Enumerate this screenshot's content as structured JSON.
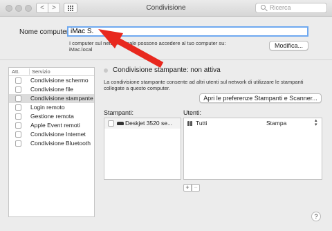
{
  "window": {
    "title": "Condivisione"
  },
  "toolbar": {
    "search_placeholder": "Ricerca",
    "back_glyph": "<",
    "forward_glyph": ">"
  },
  "computer": {
    "label": "Nome computer:",
    "value": "iMac S.",
    "info_line1": "I computer sul network locale possono accedere al tuo computer su:",
    "info_line2": "iMac.local",
    "edit_button": "Modifica..."
  },
  "services": {
    "header_on": "Att.",
    "header_service": "Servizio",
    "items": [
      {
        "label": "Condivisione schermo",
        "checked": false,
        "selected": false
      },
      {
        "label": "Condivisione file",
        "checked": false,
        "selected": false
      },
      {
        "label": "Condivisione stampante",
        "checked": false,
        "selected": true
      },
      {
        "label": "Login remoto",
        "checked": false,
        "selected": false
      },
      {
        "label": "Gestione remota",
        "checked": false,
        "selected": false
      },
      {
        "label": "Apple Event remoti",
        "checked": false,
        "selected": false
      },
      {
        "label": "Condivisione Internet",
        "checked": false,
        "selected": false
      },
      {
        "label": "Condivisione Bluetooth",
        "checked": false,
        "selected": false
      }
    ]
  },
  "detail": {
    "status_title": "Condivisione stampante: non attiva",
    "desc_line1": "La condivisione stampante consente ad altri utenti sul network di utilizzare le stampanti",
    "desc_line2": "collegate a questo computer.",
    "prefs_button": "Apri le preferenze Stampanti e Scanner...",
    "printers_label": "Stampanti:",
    "users_label": "Utenti:",
    "printers": [
      {
        "name": "Deskjet 3520 se..."
      }
    ],
    "users": [
      {
        "name": "Tutti",
        "permission": "Stampa"
      }
    ],
    "add_glyph": "+",
    "remove_glyph": "−"
  },
  "help": {
    "glyph": "?"
  },
  "annotation": {
    "arrow_color": "#e8281e"
  }
}
